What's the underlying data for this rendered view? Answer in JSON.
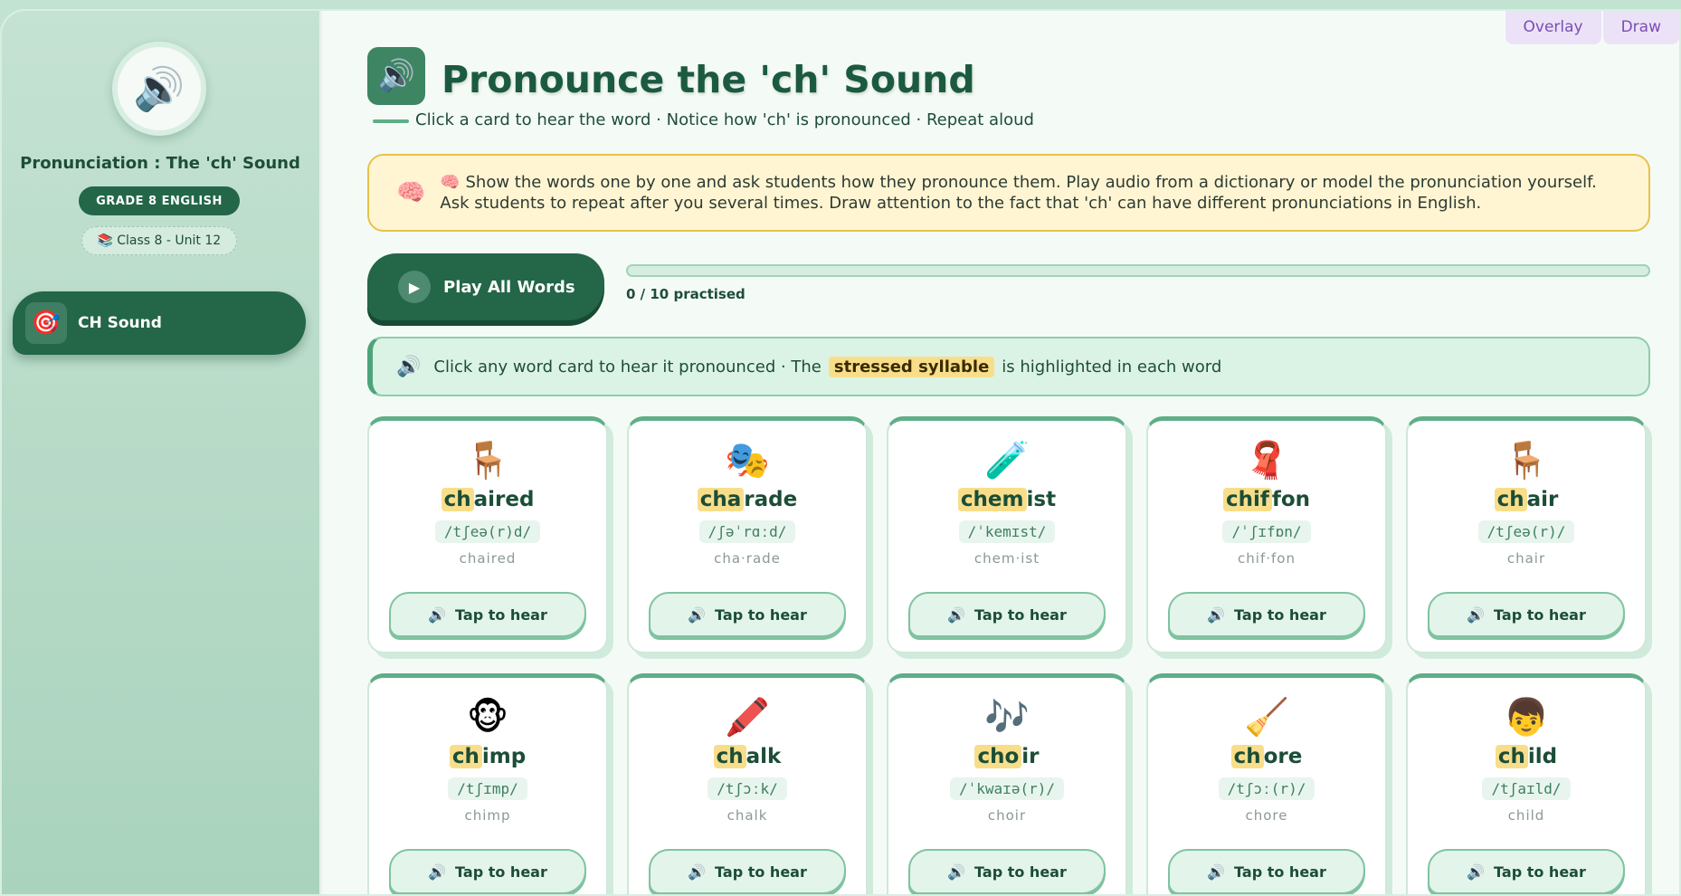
{
  "topbar": {
    "overlay_label": "Overlay",
    "draw_label": "Draw"
  },
  "sidebar": {
    "logo_icon": "🔊",
    "title": "Pronunciation : The 'ch' Sound",
    "grade": "GRADE 8 ENGLISH",
    "unit_icon": "📚",
    "unit": "Class 8 - Unit 12",
    "nav": [
      {
        "icon": "🎯",
        "label": "CH Sound"
      }
    ]
  },
  "header": {
    "icon": "🔊",
    "title": "Pronounce the 'ch' Sound",
    "subtitle": "Click a card to hear the word · Notice how 'ch' is pronounced · Repeat aloud"
  },
  "tip": {
    "icon": "🧠",
    "text": "🧠 Show the words one by one and ask students how they pronounce them. Play audio from a dictionary or model the pronunciation yourself. Ask students to repeat after you several times. Draw attention to the fact that 'ch' can have different pronunciations in English."
  },
  "controls": {
    "play_icon": "▶",
    "play_label": "Play All Words",
    "progress_text": "0 / 10 practised",
    "progress_value": 0
  },
  "info": {
    "icon": "🔊",
    "before": "Click any word card to hear it pronounced · The",
    "highlight": "stressed syllable",
    "after": "is highlighted in each word"
  },
  "tap_icon": "🔊",
  "tap_label": "Tap to hear",
  "cards": [
    {
      "emoji": "🪑",
      "stressed": "ch",
      "rest": "aired",
      "ipa": "/tʃeə(r)d/",
      "syllables": "chaired"
    },
    {
      "emoji": "🎭",
      "stressed": "cha",
      "rest": "rade",
      "ipa": "/ʃəˈrɑːd/",
      "syllables": "cha·rade"
    },
    {
      "emoji": "🧪",
      "stressed": "chem",
      "rest": "ist",
      "ipa": "/ˈkemɪst/",
      "syllables": "chem·ist"
    },
    {
      "emoji": "🧣",
      "stressed": "chif",
      "rest": "fon",
      "ipa": "/ˈʃɪfɒn/",
      "syllables": "chif·fon"
    },
    {
      "emoji": "🪑",
      "stressed": "ch",
      "rest": "air",
      "ipa": "/tʃeə(r)/",
      "syllables": "chair"
    },
    {
      "emoji": "🐵",
      "stressed": "ch",
      "rest": "imp",
      "ipa": "/tʃɪmp/",
      "syllables": "chimp"
    },
    {
      "emoji": "🖍️",
      "stressed": "ch",
      "rest": "alk",
      "ipa": "/tʃɔːk/",
      "syllables": "chalk"
    },
    {
      "emoji": "🎶",
      "stressed": "cho",
      "rest": "ir",
      "ipa": "/ˈkwaɪə(r)/",
      "syllables": "choir"
    },
    {
      "emoji": "🧹",
      "stressed": "ch",
      "rest": "ore",
      "ipa": "/tʃɔː(r)/",
      "syllables": "chore"
    },
    {
      "emoji": "👦",
      "stressed": "ch",
      "rest": "ild",
      "ipa": "/tʃaɪld/",
      "syllables": "child"
    }
  ]
}
